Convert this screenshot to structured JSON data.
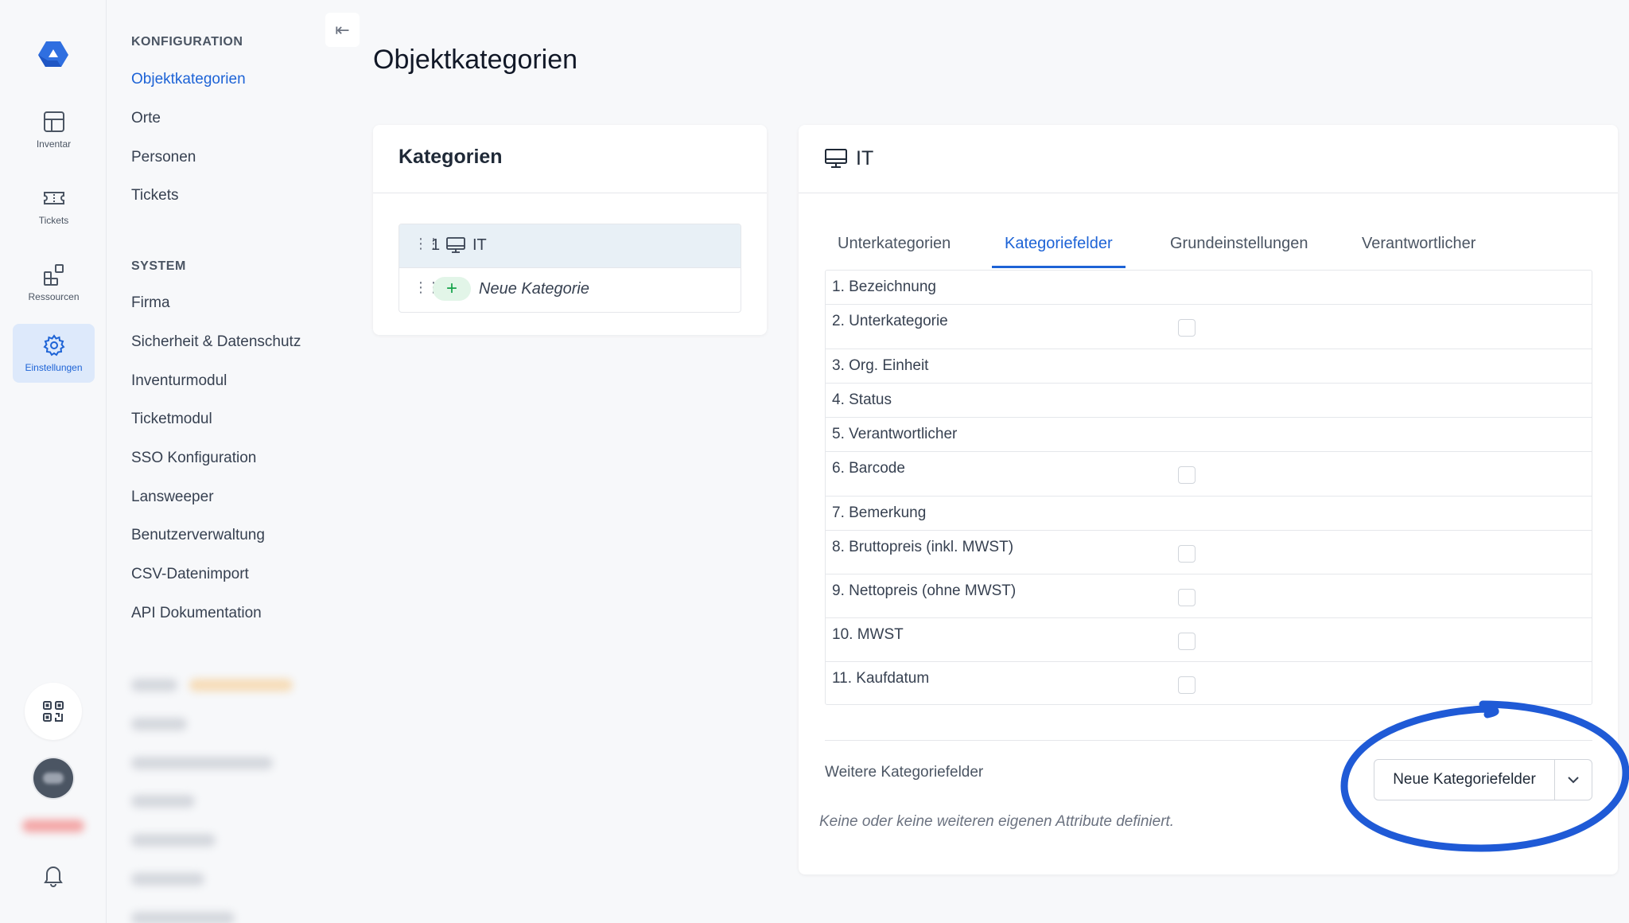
{
  "rail": {
    "items": [
      {
        "label": "Inventar",
        "icon": "grid-icon"
      },
      {
        "label": "Tickets",
        "icon": "ticket-icon"
      },
      {
        "label": "Ressourcen",
        "icon": "resources-icon"
      },
      {
        "label": "Einstellungen",
        "icon": "gear-icon",
        "active": true
      }
    ]
  },
  "nav": {
    "sections": [
      {
        "heading": "KONFIGURATION",
        "items": [
          "Objektkategorien",
          "Orte",
          "Personen",
          "Tickets"
        ],
        "active": "Objektkategorien"
      },
      {
        "heading": "SYSTEM",
        "items": [
          "Firma",
          "Sicherheit & Datenschutz",
          "Inventurmodul",
          "Ticketmodul",
          "SSO Konfiguration",
          "Lansweeper",
          "Benutzerverwaltung",
          "CSV-Datenimport",
          "API Dokumentation"
        ]
      }
    ]
  },
  "page": {
    "title": "Objektkategorien"
  },
  "categories": {
    "title": "Kategorien",
    "items": [
      {
        "number": "1",
        "name": "IT",
        "icon": "monitor-icon"
      }
    ],
    "new_label": "Neue Kategorie"
  },
  "detail": {
    "title": "IT",
    "tabs": [
      "Unterkategorien",
      "Kategoriefelder",
      "Grundeinstellungen",
      "Verantwortlicher"
    ],
    "active_tab": "Kategoriefelder",
    "fields": [
      {
        "label": "1. Bezeichnung",
        "checkbox": false
      },
      {
        "label": "2. Unterkategorie",
        "checkbox": true
      },
      {
        "label": "3. Org. Einheit",
        "checkbox": false
      },
      {
        "label": "4. Status",
        "checkbox": false
      },
      {
        "label": "5. Verantwortlicher",
        "checkbox": false
      },
      {
        "label": "6. Barcode",
        "checkbox": true
      },
      {
        "label": "7. Bemerkung",
        "checkbox": false
      },
      {
        "label": "8. Bruttopreis (inkl. MWST)",
        "checkbox": true
      },
      {
        "label": "9. Nettopreis (ohne MWST)",
        "checkbox": true
      },
      {
        "label": "10. MWST",
        "checkbox": true
      },
      {
        "label": "11. Kaufdatum",
        "checkbox": true
      }
    ],
    "more_label": "Weitere Kategoriefelder",
    "more_empty": "Keine oder keine weiteren eigenen Attribute definiert.",
    "new_button": "Neue Kategoriefelder"
  },
  "colors": {
    "accent": "#1d63d6",
    "annotation": "#1f5ad6",
    "add_green": "#16a34a"
  }
}
